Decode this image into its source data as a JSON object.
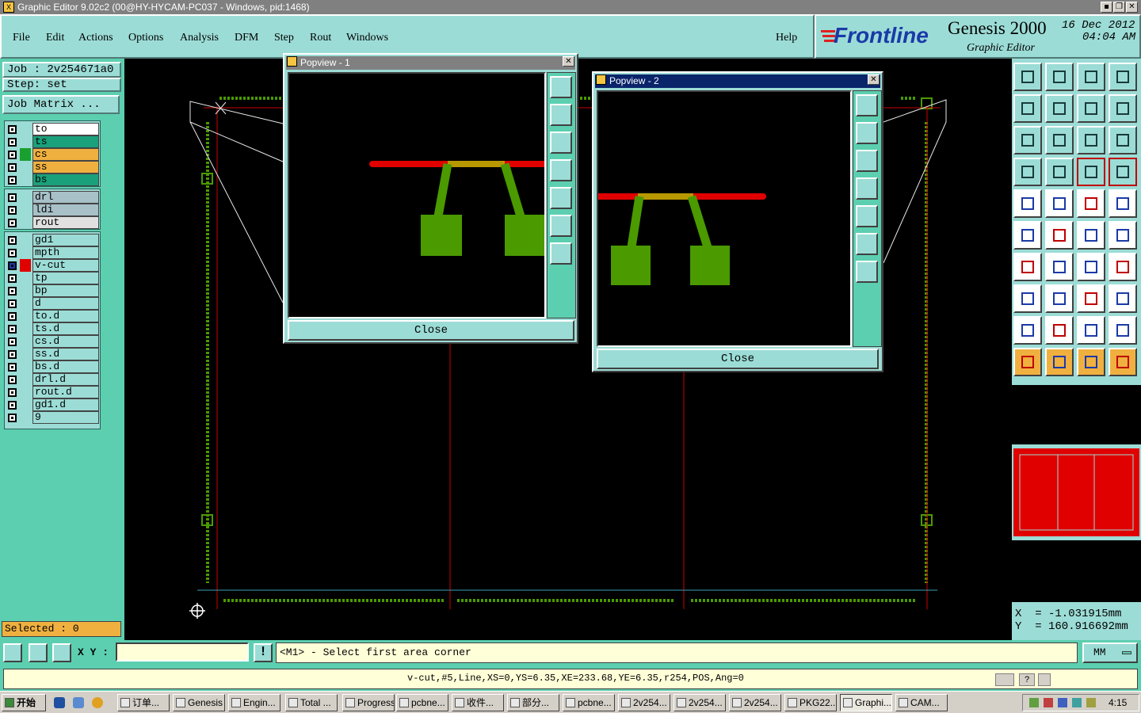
{
  "titlebar": {
    "text": "Graphic Editor 9.02c2 (00@HY-HYCAM-PC037 - Windows, pid:1468)"
  },
  "menu": [
    "File",
    "Edit",
    "Actions",
    "Options",
    "Analysis",
    "DFM",
    "Step",
    "Rout",
    "Windows"
  ],
  "help_label": "Help",
  "brand": {
    "logo": "Frontline",
    "product": "Genesis 2000",
    "subtitle": "Graphic Editor",
    "date": "16 Dec 2012",
    "time": "04:04 AM"
  },
  "job": {
    "job_line": "Job : 2v254671a0",
    "step_line": "Step: set",
    "matrix_button": "Job Matrix ..."
  },
  "layers": {
    "group1": [
      {
        "name": "to",
        "color": "#ffffff"
      },
      {
        "name": "ts",
        "color": "#1aa07a"
      },
      {
        "name": "cs",
        "color": "#f0b040",
        "swatch": "#1aa030"
      },
      {
        "name": "ss",
        "color": "#f0b040"
      },
      {
        "name": "bs",
        "color": "#1aa07a"
      }
    ],
    "group2": [
      {
        "name": "drl",
        "color": "#a8c0c8"
      },
      {
        "name": "ldi",
        "color": "#a8c0c8"
      },
      {
        "name": "rout",
        "color": "#e0e0e0"
      }
    ],
    "group3": [
      {
        "name": "gd1",
        "color": "#9cdcd6"
      },
      {
        "name": "mpth",
        "color": "#9cdcd6"
      },
      {
        "name": "v-cut",
        "color": "#9cdcd6",
        "swatch": "#e00000",
        "active": true
      },
      {
        "name": "tp",
        "color": "#9cdcd6"
      },
      {
        "name": "bp",
        "color": "#9cdcd6"
      },
      {
        "name": "d",
        "color": "#9cdcd6"
      },
      {
        "name": "to.d",
        "color": "#9cdcd6"
      },
      {
        "name": "ts.d",
        "color": "#9cdcd6"
      },
      {
        "name": "cs.d",
        "color": "#9cdcd6"
      },
      {
        "name": "ss.d",
        "color": "#9cdcd6"
      },
      {
        "name": "bs.d",
        "color": "#9cdcd6"
      },
      {
        "name": "drl.d",
        "color": "#9cdcd6"
      },
      {
        "name": "rout.d",
        "color": "#9cdcd6"
      },
      {
        "name": "gd1.d",
        "color": "#9cdcd6"
      },
      {
        "name": "9",
        "color": "#9cdcd6"
      }
    ]
  },
  "selected": "Selected : 0",
  "popview1": {
    "title": "Popview - 1",
    "close_label": "Close"
  },
  "popview2": {
    "title": "Popview - 2",
    "close_label": "Close"
  },
  "coords": {
    "x": "X  = -1.031915mm",
    "y": "Y  = 160.916692mm"
  },
  "cmd": {
    "xy_label": "X Y :",
    "input_value": "",
    "prompt": "<M1> - Select first area corner",
    "units": "MM"
  },
  "status": "v-cut,#5,Line,XS=0,YS=6.35,XE=233.68,YE=6.35,r254,POS,Ang=0",
  "taskbar": {
    "start": "开始",
    "tasks": [
      "订单...",
      "Genesis",
      "Engin...",
      "Total ...",
      "Progress",
      "pcbne...",
      "收件...",
      "部分...",
      "pcbne...",
      "2v254...",
      "2v254...",
      "2v254...",
      "PKG22...",
      "Graphi...",
      "CAM..."
    ],
    "clock": "4:15"
  },
  "colors": {
    "teal": "#9cdcd6",
    "green": "#5ccfb0",
    "vcut_red": "#e00000",
    "pad_green": "#4a9a00",
    "trace_gold": "#b89800"
  }
}
